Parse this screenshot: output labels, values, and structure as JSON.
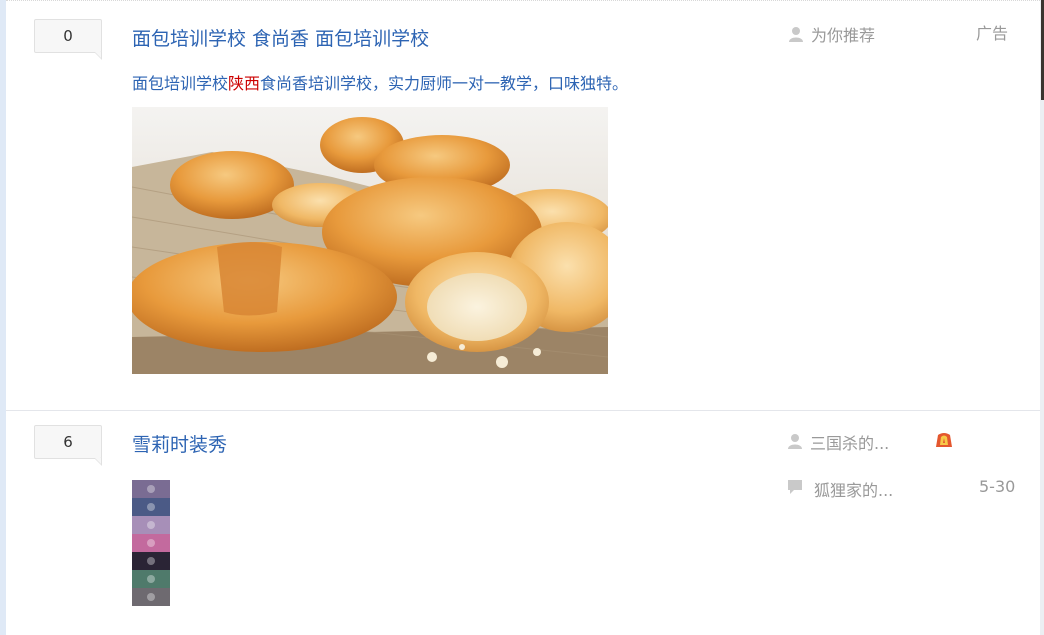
{
  "threads": [
    {
      "reply_count": "0",
      "title": "面包培训学校 食尚香 面包培训学校",
      "abstract_pre": "面包培训学校",
      "abstract_highlight": "陕西",
      "abstract_post": "食尚香培训学校，实力厨师一对一教学，口味独特。",
      "author": "为你推荐",
      "ad_label": "广告",
      "image_icon": "croissant-photo"
    },
    {
      "reply_count": "6",
      "title": "雪莉时装秀",
      "author": "三国杀的...",
      "author_badge_icon": "flame-badge-icon",
      "last_replier": "狐狸家的...",
      "last_reply_time": "5-30",
      "image_icon": "fashion-thumbnail"
    }
  ],
  "colors": {
    "link": "#2d64b3",
    "highlight": "#cc0000",
    "meta": "#999999"
  }
}
